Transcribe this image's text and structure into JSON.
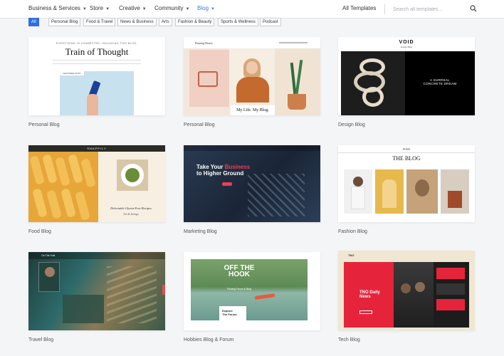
{
  "nav": {
    "items": [
      {
        "label": "Business & Services"
      },
      {
        "label": "Store"
      },
      {
        "label": "Creative"
      },
      {
        "label": "Community"
      },
      {
        "label": "Blog"
      }
    ],
    "all_templates": "All Templates",
    "search_placeholder": "Search all templates...",
    "search_icon": "search-icon"
  },
  "filters": [
    "All",
    "Personal Blog",
    "Food & Travel",
    "News & Business",
    "Arts",
    "Fashion & Beauty",
    "Sports & Wellness",
    "Podcast"
  ],
  "colors": {
    "accent": "#2f6fde",
    "nav_active": "#3b7ddd",
    "page_bg": "#f4f5f7",
    "tech_red": "#e5243b",
    "marketing_red": "#ef3b55"
  },
  "cards": [
    {
      "label": "Personal Blog",
      "preview": {
        "tagline": "EVERYTHING IS CONNECTED. INCLUDING THIS BLOG.",
        "title": "Train of Thought",
        "tag": "FEATURED POST"
      }
    },
    {
      "label": "Personal Blog",
      "preview": {
        "brand": "Burning Hearts",
        "caption": "My Life. My Blog."
      }
    },
    {
      "label": "Design Blog",
      "preview": {
        "brand": "VOID",
        "subtitle": "Design Blog",
        "headline": "A SURREAL CONCRETE DREAM"
      }
    },
    {
      "label": "Food Blog",
      "preview": {
        "brand": "SNAPPILY",
        "caption": "Delectable Gluten-Free Recipes",
        "byline": "Art & Strings"
      }
    },
    {
      "label": "Marketing Blog",
      "preview": {
        "headline_pre": "Take Your ",
        "headline_highlight": "Business",
        "headline_post": "to Higher Ground"
      }
    },
    {
      "label": "Fashion Blog",
      "preview": {
        "brand": "POSE",
        "title": "THE BLOG"
      }
    },
    {
      "label": "Travel Blog",
      "preview": {
        "brand": "On The Trail"
      }
    },
    {
      "label": "Hobbies Blog & Forum",
      "preview": {
        "headline": "OFF THE HOOK",
        "subtitle": "Fishing Forum & Blog",
        "box_line1": "Explore",
        "box_line2": "The Forum"
      }
    },
    {
      "label": "Tech Blog",
      "preview": {
        "brand": "TNO",
        "title": "TNO Daily News"
      }
    }
  ]
}
